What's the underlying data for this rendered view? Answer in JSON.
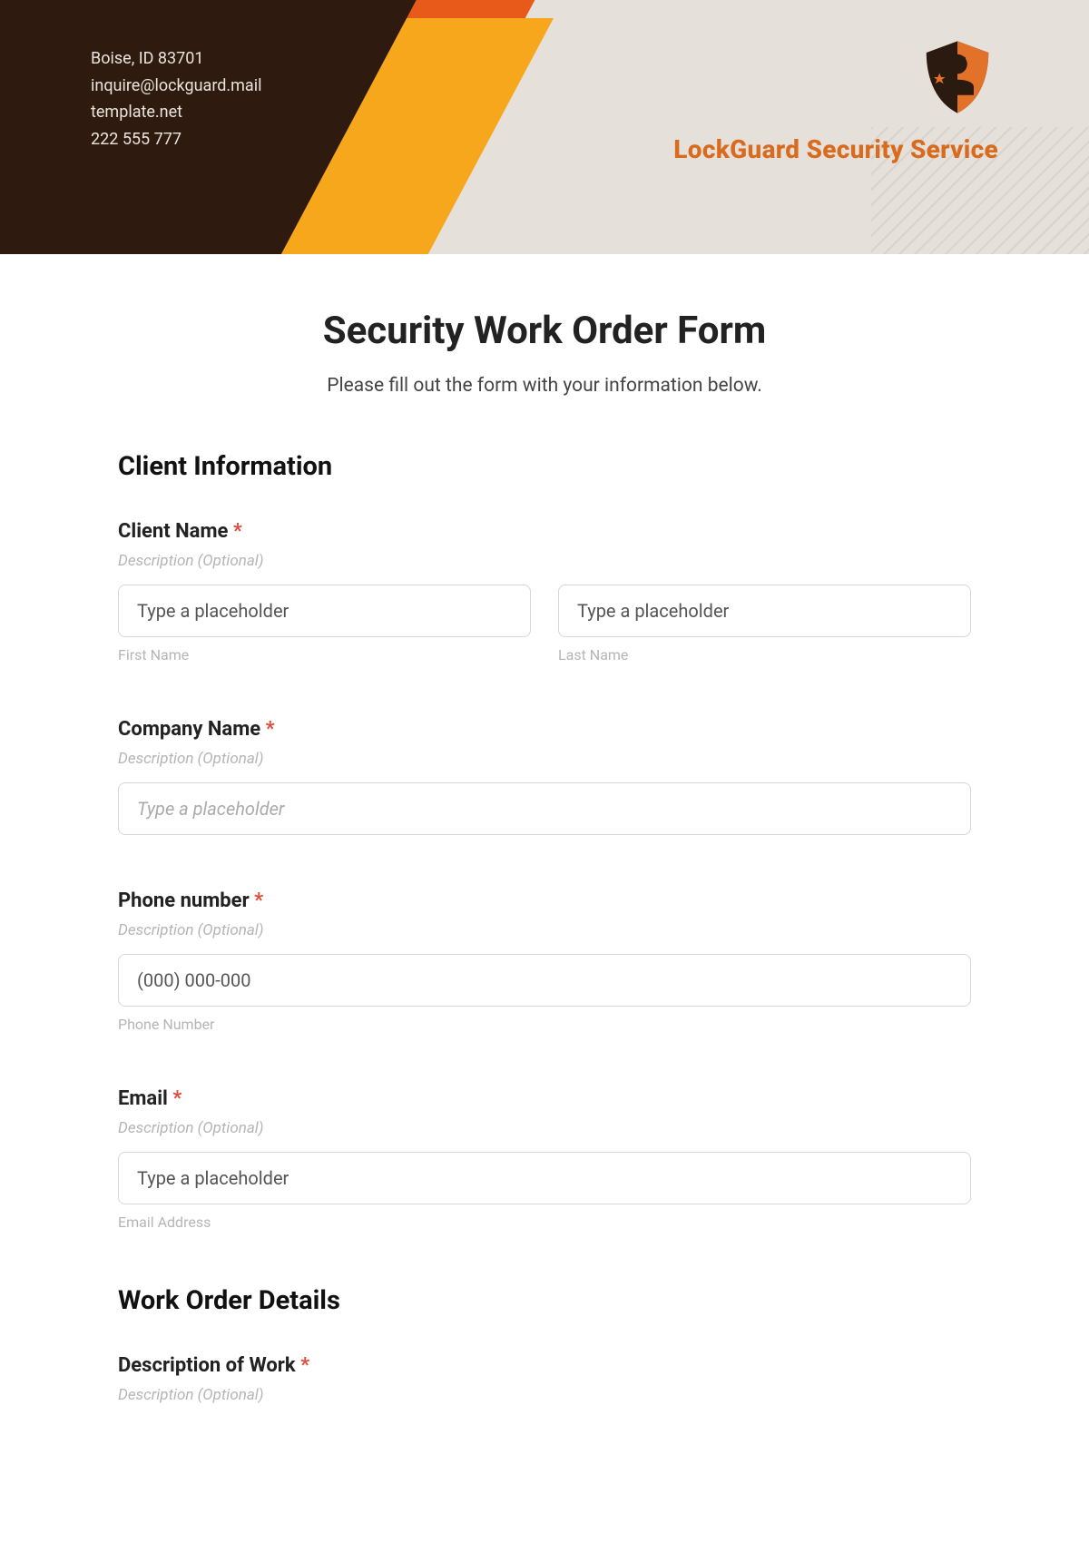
{
  "header": {
    "contact": {
      "line1": "Boise, ID 83701",
      "line2": "inquire@lockguard.mail",
      "line3": "template.net",
      "line4": "222 555 777"
    },
    "brand": "LockGuard Security Service"
  },
  "form": {
    "title": "Security Work Order Form",
    "subtitle": "Please fill out the form with your information below.",
    "section_client": "Client Information",
    "client_name": {
      "label": "Client Name",
      "required": "*",
      "desc": "Description (Optional)",
      "first_placeholder": "Type a placeholder",
      "last_placeholder": "Type a placeholder",
      "first_sublabel": "First Name",
      "last_sublabel": "Last Name"
    },
    "company": {
      "label": "Company Name",
      "required": "*",
      "desc": "Description (Optional)",
      "placeholder": "Type a placeholder"
    },
    "phone": {
      "label": "Phone number",
      "required": "*",
      "desc": "Description (Optional)",
      "placeholder": "(000) 000-000",
      "sublabel": "Phone Number"
    },
    "email": {
      "label": "Email",
      "required": "*",
      "desc": "Description (Optional)",
      "placeholder": "Type a placeholder",
      "sublabel": "Email Address"
    },
    "section_work": "Work Order Details",
    "work_desc": {
      "label": "Description of Work",
      "required": "*",
      "desc": "Description (Optional)"
    }
  }
}
